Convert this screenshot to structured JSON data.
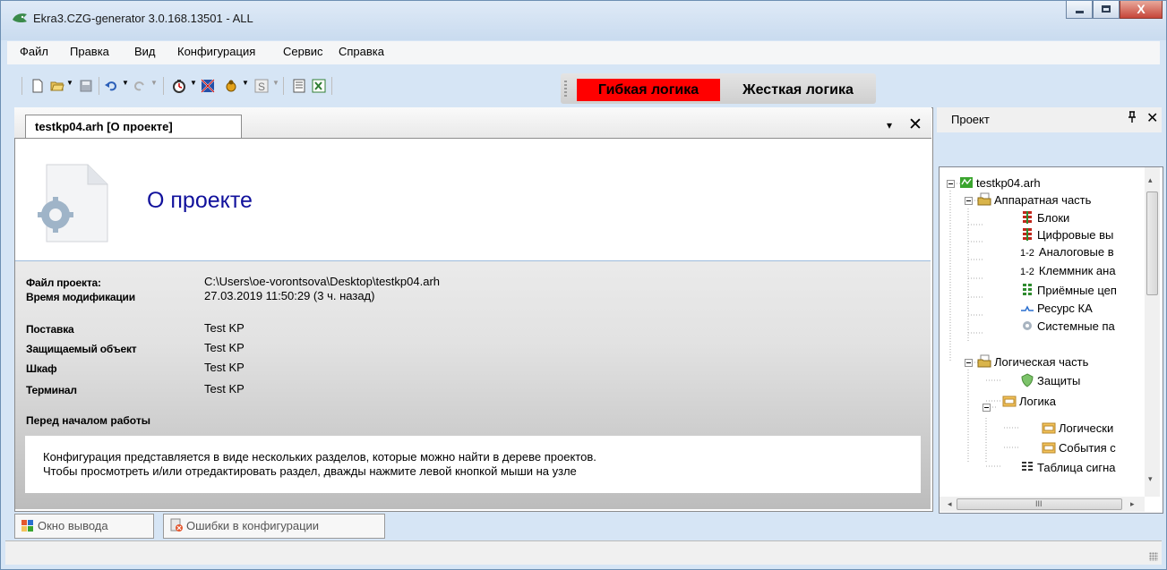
{
  "window": {
    "title": "Ekra3.CZG-generator 3.0.168.13501 - ALL",
    "close_glyph": "X"
  },
  "menu": [
    "Файл",
    "Правка",
    "Вид",
    "Конфигурация",
    "Сервис",
    "Справка"
  ],
  "toolbar": {
    "icons": [
      "new-file-icon",
      "open-folder-icon",
      "save-icon",
      "undo-icon",
      "redo-icon",
      "timer-icon",
      "flag-icon",
      "bug-icon",
      "dollar-icon",
      "list-icon",
      "excel-icon"
    ]
  },
  "logic_mode": {
    "flex": "Гибкая логика",
    "hard": "Жесткая логика",
    "active_color": "#ff0000"
  },
  "document": {
    "tab_label": "testkp04.arh [О проекте]",
    "close_glyph": "✕",
    "dropdown_glyph": "▾",
    "page_title": "О проекте",
    "fields": [
      {
        "label": "Файл проекта:",
        "value": "C:\\Users\\oe-vorontsova\\Desktop\\testkp04.arh"
      },
      {
        "label": "Время модификации",
        "value": "27.03.2019 11:50:29 (3 ч. назад)"
      },
      {
        "label": "Поставка",
        "value": "Test KP"
      },
      {
        "label": "Защищаемый объект",
        "value": "Test KP"
      },
      {
        "label": "Шкаф",
        "value": "Test KP"
      },
      {
        "label": "Терминал",
        "value": "Test KP"
      }
    ],
    "before_start_title": "Перед началом работы",
    "before_start_lines": [
      "Конфигурация представляется в виде нескольких разделов, которые можно найти в дереве проектов.",
      "Чтобы просмотреть и/или отредактировать раздел, дважды нажмите левой кнопкой мыши на узле"
    ]
  },
  "project_panel": {
    "title": "Проект",
    "pin_glyph": "ᵩ",
    "close_glyph": "✕",
    "tree": [
      {
        "label": "testkp04.arh",
        "icon": "project-icon"
      },
      {
        "label": "Аппаратная часть",
        "icon": "folder-icon"
      },
      {
        "label": "Блоки",
        "icon": "blocks-icon"
      },
      {
        "label": "Цифровые вы",
        "icon": "digital-icon"
      },
      {
        "label": "Аналоговые в",
        "icon": "analog-icon"
      },
      {
        "label": "Клеммник ана",
        "icon": "analog-icon"
      },
      {
        "label": "Приёмные цеп",
        "icon": "receive-icon"
      },
      {
        "label": "Ресурс КА",
        "icon": "resource-icon"
      },
      {
        "label": "Системные па",
        "icon": "gear-icon"
      },
      {
        "label": "Логическая часть",
        "icon": "folder-icon"
      },
      {
        "label": "Защиты",
        "icon": "shield-icon"
      },
      {
        "label": "Логика",
        "icon": "logic-icon"
      },
      {
        "label": "Логически",
        "icon": "logic-icon"
      },
      {
        "label": "События с",
        "icon": "logic-icon"
      },
      {
        "label": "Таблица сигна",
        "icon": "table-icon"
      }
    ],
    "analog_glyph": "1-2",
    "scroll_left": "◂",
    "scroll_right": "▸",
    "scroll_up": "▴",
    "scroll_down": "▾",
    "hscroll_mark": "III"
  },
  "bottom_tabs": [
    {
      "label": "Окно вывода",
      "icon": "output-window-icon"
    },
    {
      "label": "Ошибки в конфигурации",
      "icon": "config-errors-icon"
    }
  ]
}
